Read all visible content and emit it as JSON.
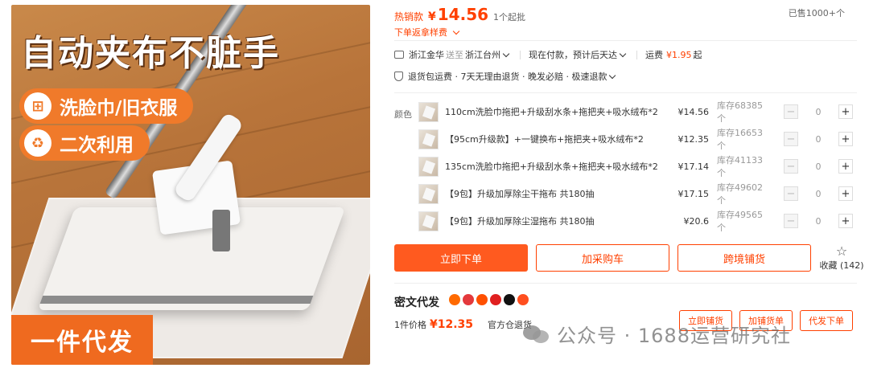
{
  "image": {
    "headline": "自动夹布不脏手",
    "feature_1": "洗脸巾/旧衣服",
    "feature_2": "二次利用",
    "bottom_banner": "一件代发"
  },
  "price": {
    "hot_label": "热销款",
    "currency": "¥",
    "amount": "14.56",
    "min_order": "1个起批",
    "sold": "已售1000+个"
  },
  "sample": {
    "label": "下单返拿样费"
  },
  "shipping": {
    "from": "浙江金华",
    "to_label": "送至",
    "to": "浙江台州",
    "delivery": "现在付款，预计后天达",
    "fee_label": "运费",
    "fee": "¥1.95",
    "fee_suffix": "起"
  },
  "service": {
    "text": "退货包运费 · 7天无理由退货 · 晚发必赔 · 极速退款"
  },
  "sku": {
    "color_label": "颜色",
    "items": [
      {
        "name": "110cm洗脸巾拖把+升级刮水条+拖把夹+吸水绒布*2",
        "price": "¥14.56",
        "stock": "库存68385个",
        "qty": "0"
      },
      {
        "name": "【95cm升级款】+一键换布+拖把夹+吸水绒布*2",
        "price": "¥12.35",
        "stock": "库存16653个",
        "qty": "0"
      },
      {
        "name": "135cm洗脸巾拖把+升级刮水条+拖把夹+吸水绒布*2",
        "price": "¥17.14",
        "stock": "库存41133个",
        "qty": "0"
      },
      {
        "name": "【9包】升级加厚除尘干拖布 共180抽",
        "price": "¥17.15",
        "stock": "库存49602个",
        "qty": "0"
      },
      {
        "name": "【9包】升级加厚除尘湿拖布 共180抽",
        "price": "¥20.6",
        "stock": "库存49565个",
        "qty": "0"
      }
    ]
  },
  "actions": {
    "buy_now": "立即下单",
    "add_cart": "加采购车",
    "cross_border": "跨境铺货",
    "favorite": "收藏",
    "favorite_count": "(142)"
  },
  "dropship": {
    "title": "密文代发",
    "unit_price_label": "1件价格",
    "unit_price": "¥12.35",
    "return_note": "官方仓退货",
    "btn_list": "立即铺货",
    "btn_add": "加铺货单",
    "btn_order": "代发下单"
  },
  "watermark": {
    "text": "公众号 · 1688运营研究社"
  },
  "colors": {
    "accent": "#ff4000",
    "button": "#ff5a1f",
    "banner": "#ef6a1f"
  }
}
